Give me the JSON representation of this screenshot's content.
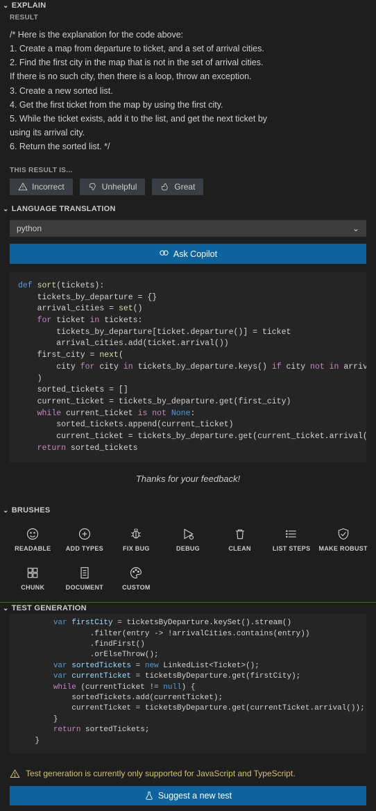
{
  "explain": {
    "header": "EXPLAIN",
    "resultLabel": "RESULT",
    "lines": [
      "/* Here is the explanation for the code above:",
      "1. Create a map from departure to ticket, and a set of arrival cities.",
      "2. Find the first city in the map that is not in the set of arrival cities.",
      "    If there is no such city, then there is a loop, throw an exception.",
      "3. Create a new sorted list.",
      "4. Get the first ticket from the map by using the first city.",
      "5. While the ticket exists, add it to the list, and get the next ticket by",
      "    using its arrival city.",
      "6. Return the sorted list. */"
    ],
    "thisResultIs": "THIS RESULT IS...",
    "buttons": {
      "incorrect": "Incorrect",
      "unhelpful": "Unhelpful",
      "great": "Great"
    }
  },
  "translation": {
    "header": "LANGUAGE TRANSLATION",
    "language": "python",
    "askCopilot": "Ask Copilot",
    "codeLines": [
      {
        "indent": 0,
        "tokens": [
          {
            "t": "def ",
            "c": "kw2"
          },
          {
            "t": "sort",
            "c": "fn"
          },
          {
            "t": "(tickets):",
            "c": ""
          }
        ]
      },
      {
        "indent": 1,
        "tokens": [
          {
            "t": "tickets_by_departure = {}",
            "c": ""
          }
        ]
      },
      {
        "indent": 1,
        "tokens": [
          {
            "t": "arrival_cities = ",
            "c": ""
          },
          {
            "t": "set",
            "c": "fn"
          },
          {
            "t": "()",
            "c": ""
          }
        ]
      },
      {
        "indent": 1,
        "tokens": [
          {
            "t": "for ",
            "c": "kw"
          },
          {
            "t": "ticket ",
            "c": ""
          },
          {
            "t": "in ",
            "c": "kw"
          },
          {
            "t": "tickets:",
            "c": ""
          }
        ]
      },
      {
        "indent": 2,
        "tokens": [
          {
            "t": "tickets_by_departure[ticket.departure()] = ticket",
            "c": ""
          }
        ]
      },
      {
        "indent": 2,
        "tokens": [
          {
            "t": "arrival_cities.add(ticket.arrival())",
            "c": ""
          }
        ]
      },
      {
        "indent": 1,
        "tokens": [
          {
            "t": "first_city = ",
            "c": ""
          },
          {
            "t": "next",
            "c": "fn"
          },
          {
            "t": "(",
            "c": ""
          }
        ]
      },
      {
        "indent": 2,
        "tokens": [
          {
            "t": "city ",
            "c": ""
          },
          {
            "t": "for ",
            "c": "kw"
          },
          {
            "t": "city ",
            "c": ""
          },
          {
            "t": "in ",
            "c": "kw"
          },
          {
            "t": "tickets_by_departure.keys() ",
            "c": ""
          },
          {
            "t": "if ",
            "c": "kw"
          },
          {
            "t": "city ",
            "c": ""
          },
          {
            "t": "not in ",
            "c": "kw"
          },
          {
            "t": "arrival_cities",
            "c": ""
          }
        ]
      },
      {
        "indent": 1,
        "tokens": [
          {
            "t": ")",
            "c": ""
          }
        ]
      },
      {
        "indent": 1,
        "tokens": [
          {
            "t": "sorted_tickets = []",
            "c": ""
          }
        ]
      },
      {
        "indent": 1,
        "tokens": [
          {
            "t": "current_ticket = tickets_by_departure.get(first_city)",
            "c": ""
          }
        ]
      },
      {
        "indent": 1,
        "tokens": [
          {
            "t": "while ",
            "c": "kw"
          },
          {
            "t": "current_ticket ",
            "c": ""
          },
          {
            "t": "is not ",
            "c": "kw"
          },
          {
            "t": "None",
            "c": "kw2"
          },
          {
            "t": ":",
            "c": ""
          }
        ]
      },
      {
        "indent": 2,
        "tokens": [
          {
            "t": "sorted_tickets.append(current_ticket)",
            "c": ""
          }
        ]
      },
      {
        "indent": 2,
        "tokens": [
          {
            "t": "current_ticket = tickets_by_departure.get(current_ticket.arrival())",
            "c": ""
          }
        ]
      },
      {
        "indent": 1,
        "tokens": [
          {
            "t": "return ",
            "c": "kw"
          },
          {
            "t": "sorted_tickets",
            "c": ""
          }
        ]
      }
    ],
    "thanks": "Thanks for your feedback!"
  },
  "brushes": {
    "header": "BRUSHES",
    "items": [
      {
        "icon": "smile",
        "label": "READABLE"
      },
      {
        "icon": "plus-circle",
        "label": "ADD TYPES"
      },
      {
        "icon": "bug",
        "label": "FIX BUG"
      },
      {
        "icon": "play",
        "label": "DEBUG"
      },
      {
        "icon": "trash",
        "label": "CLEAN"
      },
      {
        "icon": "list",
        "label": "LIST STEPS"
      },
      {
        "icon": "shield",
        "label": "MAKE ROBUST"
      },
      {
        "icon": "chunk",
        "label": "CHUNK"
      },
      {
        "icon": "doc",
        "label": "DOCUMENT"
      },
      {
        "icon": "palette",
        "label": "CUSTOM"
      }
    ]
  },
  "testgen": {
    "header": "TEST GENERATION",
    "codeLines": [
      {
        "indent": 2,
        "tokens": [
          {
            "t": "var ",
            "c": "kw2"
          },
          {
            "t": "firstCity",
            "c": "var"
          },
          {
            "t": " = ticketsByDeparture.keySet().stream()",
            "c": ""
          }
        ]
      },
      {
        "indent": 4,
        "tokens": [
          {
            "t": ".filter(entry -> !arrivalCities.contains(entry))",
            "c": ""
          }
        ]
      },
      {
        "indent": 4,
        "tokens": [
          {
            "t": ".findFirst()",
            "c": ""
          }
        ]
      },
      {
        "indent": 4,
        "tokens": [
          {
            "t": ".orElseThrow();",
            "c": ""
          }
        ]
      },
      {
        "indent": 2,
        "tokens": [
          {
            "t": "var ",
            "c": "kw2"
          },
          {
            "t": "sortedTickets",
            "c": "var"
          },
          {
            "t": " = ",
            "c": ""
          },
          {
            "t": "new ",
            "c": "kw2"
          },
          {
            "t": "LinkedList<Ticket>();",
            "c": ""
          }
        ]
      },
      {
        "indent": 2,
        "tokens": [
          {
            "t": "var ",
            "c": "kw2"
          },
          {
            "t": "currentTicket",
            "c": "var"
          },
          {
            "t": " = ticketsByDeparture.get(firstCity);",
            "c": ""
          }
        ]
      },
      {
        "indent": 2,
        "tokens": [
          {
            "t": "while ",
            "c": "kw"
          },
          {
            "t": "(currentTicket != ",
            "c": ""
          },
          {
            "t": "null",
            "c": "kw2"
          },
          {
            "t": ") {",
            "c": ""
          }
        ]
      },
      {
        "indent": 3,
        "tokens": [
          {
            "t": "sortedTickets.add(currentTicket);",
            "c": ""
          }
        ]
      },
      {
        "indent": 3,
        "tokens": [
          {
            "t": "currentTicket = ticketsByDeparture.get(currentTicket.arrival());",
            "c": ""
          }
        ]
      },
      {
        "indent": 2,
        "tokens": [
          {
            "t": "}",
            "c": ""
          }
        ]
      },
      {
        "indent": 2,
        "tokens": [
          {
            "t": "return ",
            "c": "kw"
          },
          {
            "t": "sortedTickets;",
            "c": ""
          }
        ]
      },
      {
        "indent": 1,
        "tokens": [
          {
            "t": "}",
            "c": ""
          }
        ]
      }
    ],
    "warning": "Test generation is currently only supported for JavaScript and TypeScript.",
    "suggestBtn": "Suggest a new test"
  }
}
